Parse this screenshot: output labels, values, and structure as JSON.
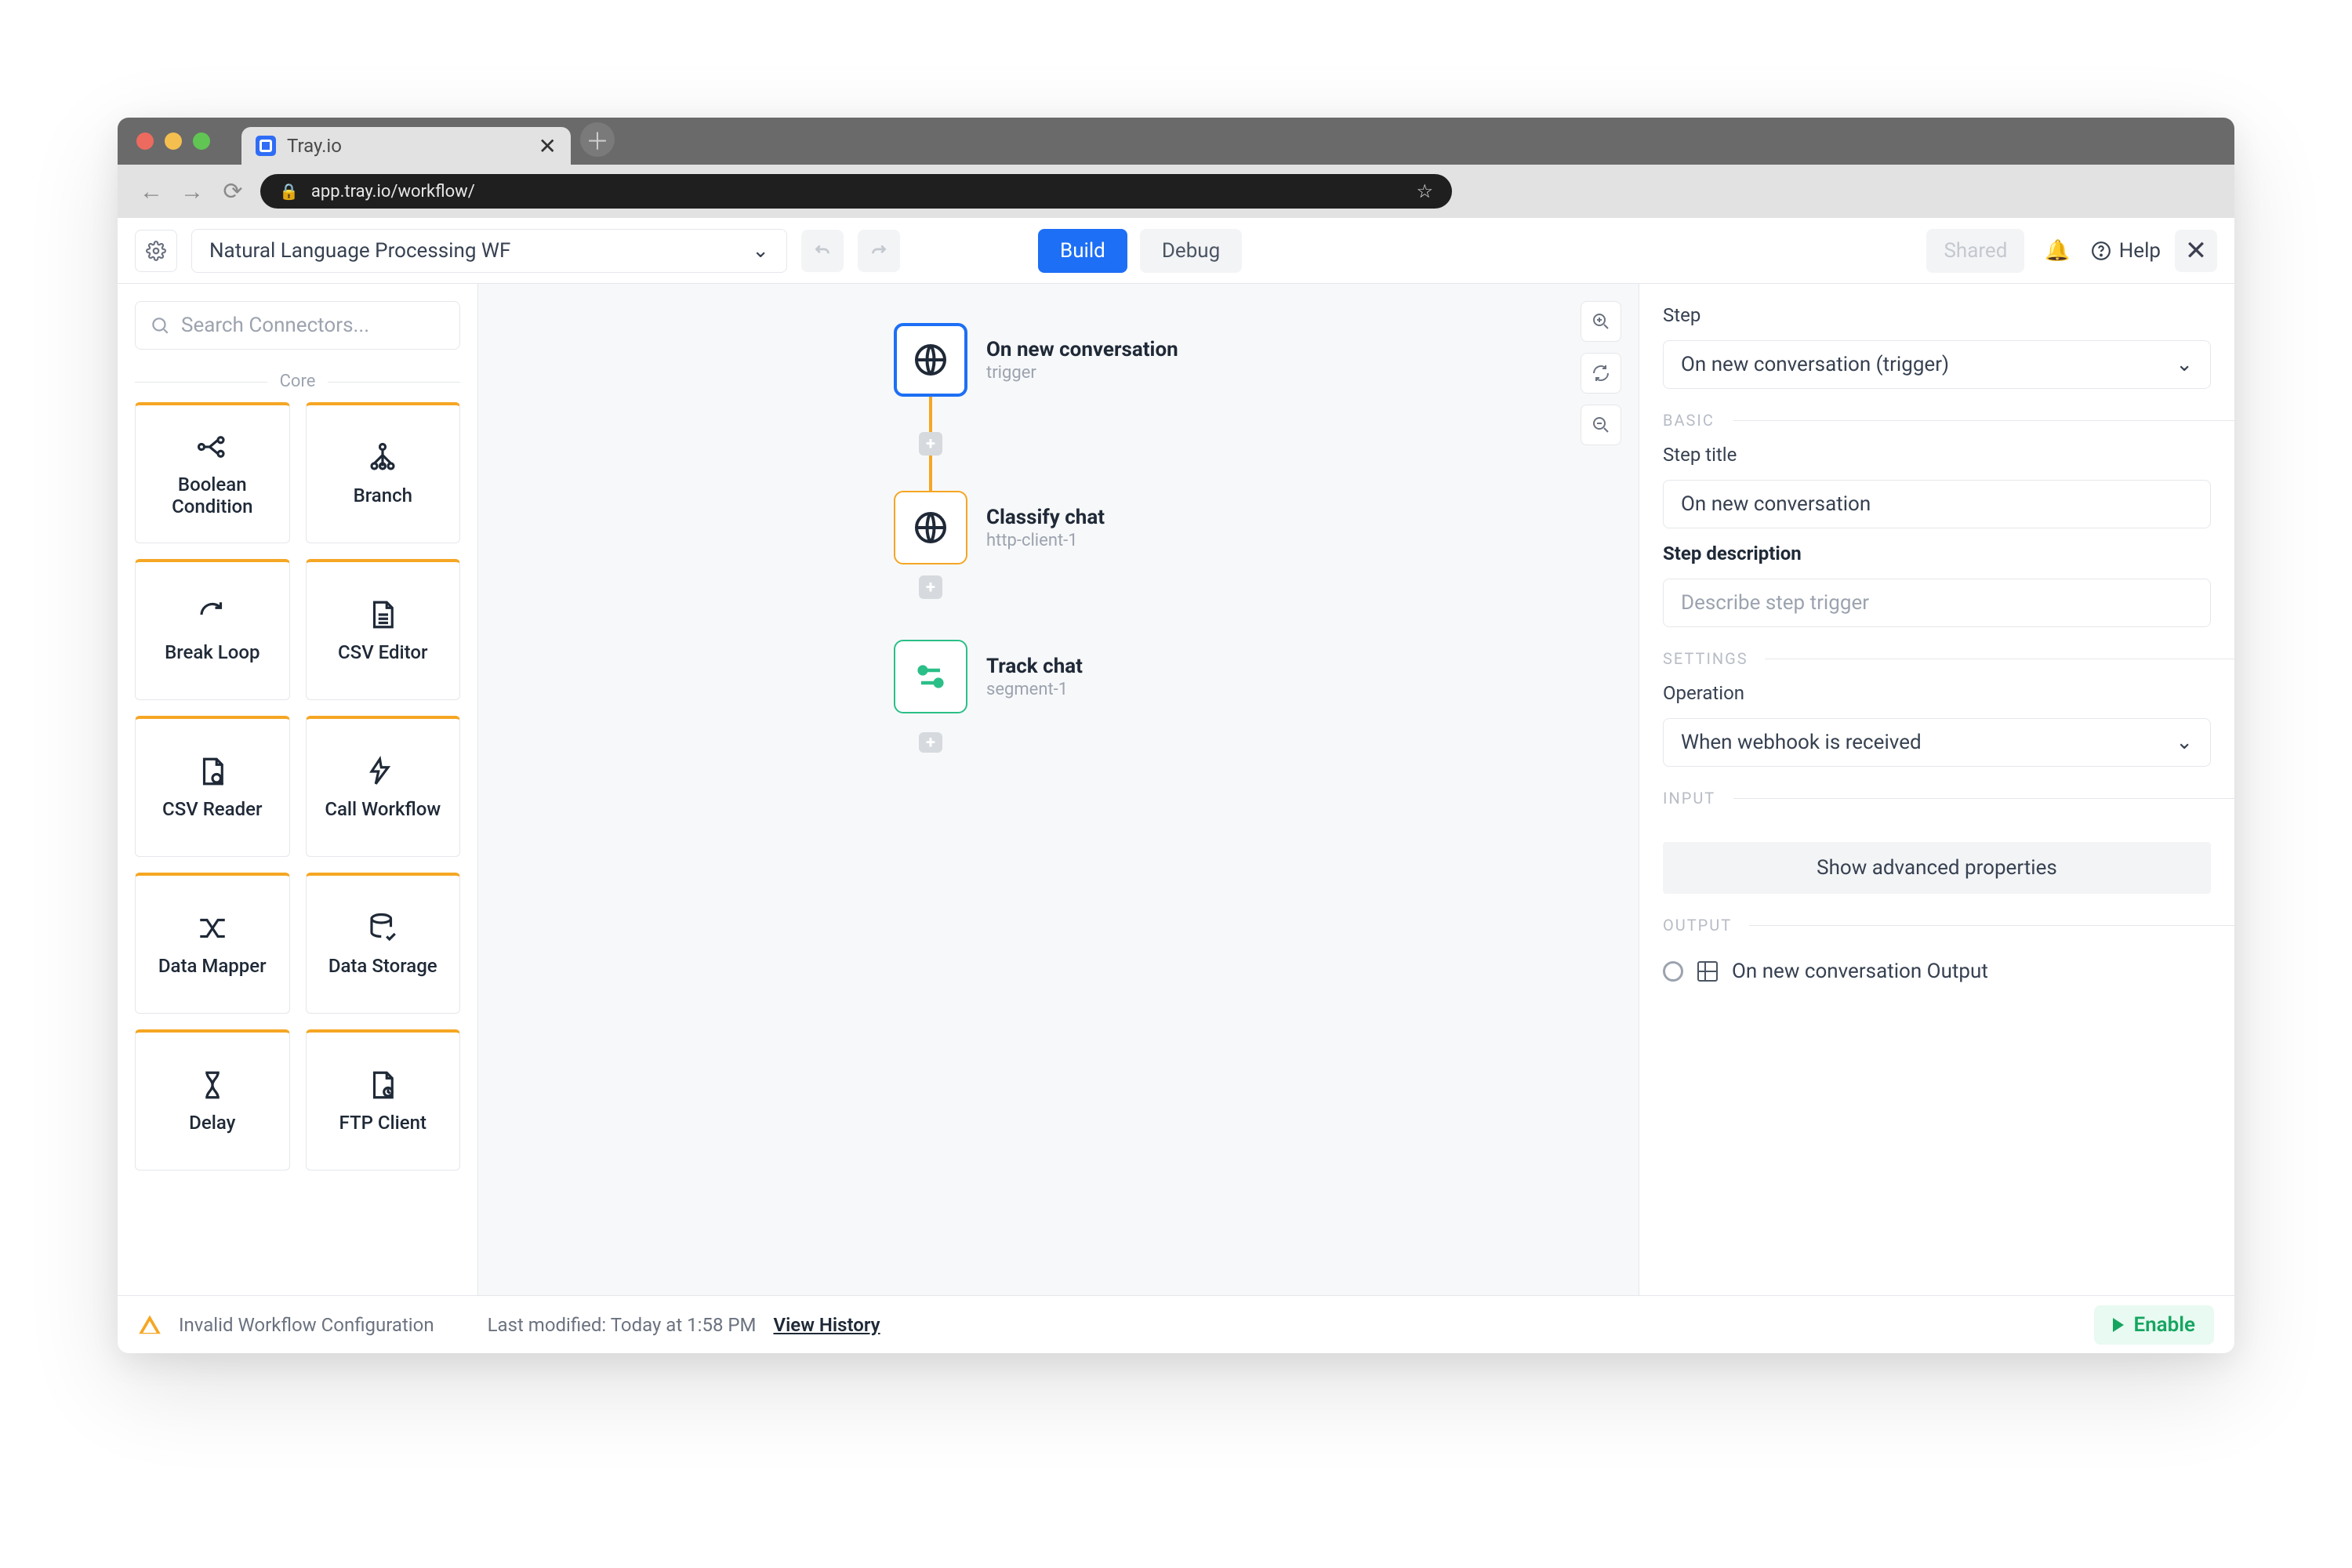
{
  "browser": {
    "tab_title": "Tray.io",
    "url": "app.tray.io/workflow/"
  },
  "toolbar": {
    "workflow_name": "Natural Language Processing WF",
    "build_label": "Build",
    "debug_label": "Debug",
    "shared_label": "Shared",
    "help_label": "Help"
  },
  "sidebar": {
    "search_placeholder": "Search Connectors...",
    "core_label": "Core",
    "connectors": [
      {
        "label": "Boolean Condition"
      },
      {
        "label": "Branch"
      },
      {
        "label": "Break Loop"
      },
      {
        "label": "CSV Editor"
      },
      {
        "label": "CSV Reader"
      },
      {
        "label": "Call Workflow"
      },
      {
        "label": "Data Mapper"
      },
      {
        "label": "Data Storage"
      },
      {
        "label": "Delay"
      },
      {
        "label": "FTP Client"
      }
    ]
  },
  "canvas": {
    "nodes": [
      {
        "title": "On new conversation",
        "sub": "trigger"
      },
      {
        "title": "Classify chat",
        "sub": "http-client-1"
      },
      {
        "title": "Track chat",
        "sub": "segment-1"
      }
    ]
  },
  "right": {
    "step_label": "Step",
    "step_select": "On new conversation (trigger)",
    "basic_label": "BASIC",
    "step_title_label": "Step title",
    "step_title_value": "On new conversation",
    "step_desc_label": "Step description",
    "step_desc_placeholder": "Describe step trigger",
    "settings_label": "SETTINGS",
    "operation_label": "Operation",
    "operation_value": "When webhook is received",
    "input_label": "INPUT",
    "advanced_label": "Show advanced properties",
    "output_label": "OUTPUT",
    "output_row": "On new conversation Output"
  },
  "footer": {
    "warning": "Invalid Workflow Configuration",
    "modified": "Last modified: Today at 1:58 PM",
    "history": "View History",
    "enable": "Enable"
  }
}
